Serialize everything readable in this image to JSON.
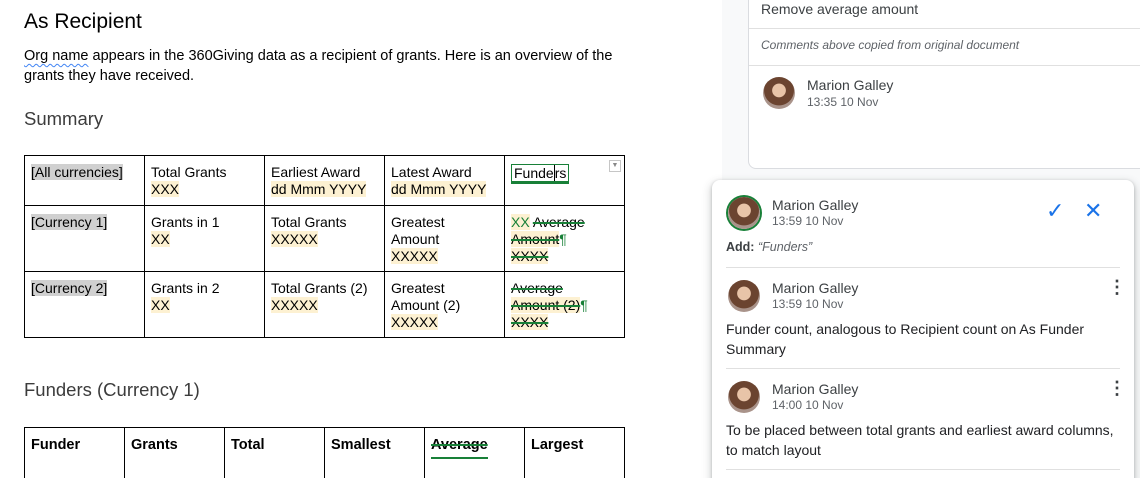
{
  "doc": {
    "title": "As Recipient",
    "intro_squiggle": "Org name",
    "intro_rest": " appears in the 360Giving data as a recipient of grants. Here is an overview of the grants they have received.",
    "summary_heading": "Summary",
    "summary_table": {
      "row1": {
        "c1": "[All currencies]",
        "c2a": "Total Grants",
        "c2b": "XXX",
        "c3a": "Earliest Award",
        "c3b": "dd Mmm YYYY",
        "c4a": "Latest Award",
        "c4b": "dd Mmm YYYY",
        "c5_a": "Funde",
        "c5_b": "rs"
      },
      "row2": {
        "c1": "[Currency 1]",
        "c2a": "Grants in 1",
        "c2b": "XX",
        "c3a": "Total Grants",
        "c3b": "XXXXX",
        "c4a": "Greatest",
        "c4b": "Amount",
        "c4c": "XXXXX",
        "c5_ins": "XX",
        "c5_del1": "Average",
        "c5_del2": "Amount",
        "c5_pil": "¶",
        "c5_del3": "XXXX"
      },
      "row3": {
        "c1": "[Currency 2]",
        "c2a": "Grants in 2",
        "c2b": "XX",
        "c3a": "Total Grants (2)",
        "c3b": "XXXXX",
        "c4a": "Greatest",
        "c4b": "Amount (2)",
        "c4c": "XXXXX",
        "c5_del1": "Average",
        "c5_del2": "Amount (2)",
        "c5_pil": "¶",
        "c5_del3": "XXXX"
      }
    },
    "funders_heading": "Funders (Currency 1)",
    "funders_table": {
      "headers": [
        "Funder",
        "Grants",
        "Total",
        "Smallest",
        "Average",
        "Largest"
      ]
    }
  },
  "comments": {
    "card1": {
      "text": "Remove average amount",
      "copied_note": "Comments above copied from original document",
      "author": "Marion Galley",
      "time": "13:35 10 Nov"
    },
    "card2": {
      "author": "Marion Galley",
      "time": "13:59 10 Nov",
      "suggest_label": "Add:",
      "suggest_value": "“Funders”",
      "replies": [
        {
          "author": "Marion Galley",
          "time": "13:59 10 Nov",
          "text": "Funder count, analogous to Recipient count on As Funder Summary"
        },
        {
          "author": "Marion Galley",
          "time": "14:00 10 Nov",
          "text": "To be placed between total grants and earliest award columns, to match layout"
        }
      ]
    },
    "icons": {
      "accept": "check-icon",
      "reject": "close-icon",
      "more": "more-vert-icon"
    },
    "colors": {
      "accent_blue": "#1a73e8",
      "suggestion_green": "#188038",
      "highlight_yellow": "#fdf1d2"
    }
  }
}
